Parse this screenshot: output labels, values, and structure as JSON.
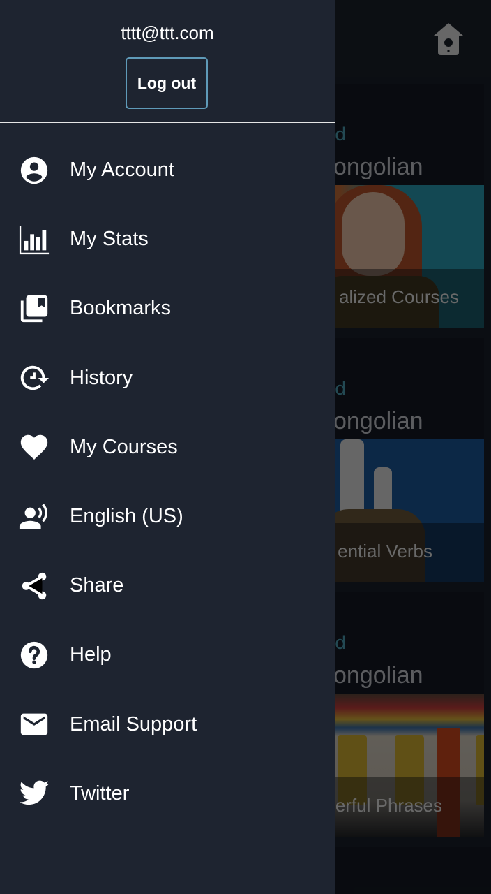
{
  "drawer": {
    "user_email": "tttt@ttt.com",
    "logout_label": "Log out",
    "items": [
      {
        "label": "My Account",
        "icon": "account-circle-icon"
      },
      {
        "label": "My Stats",
        "icon": "bar-chart-icon"
      },
      {
        "label": "Bookmarks",
        "icon": "bookmarks-icon"
      },
      {
        "label": "History",
        "icon": "history-icon"
      },
      {
        "label": "My Courses",
        "icon": "heart-icon"
      },
      {
        "label": "English (US)",
        "icon": "voice-language-icon"
      },
      {
        "label": "Share",
        "icon": "share-icon"
      },
      {
        "label": "Help",
        "icon": "help-circle-icon"
      },
      {
        "label": "Email Support",
        "icon": "email-icon"
      },
      {
        "label": "Twitter",
        "icon": "twitter-icon"
      }
    ]
  },
  "background": {
    "header_icon": "birdhouse-home-icon",
    "courses": [
      {
        "level_fragment": "d",
        "language_fragment": "ongolian",
        "title_fragment": "alized Courses"
      },
      {
        "level_fragment": "d",
        "language_fragment": "ongolian",
        "title_fragment": "ential Verbs"
      },
      {
        "level_fragment": "d",
        "language_fragment": "ongolian",
        "title_fragment": "erful Phrases"
      }
    ]
  },
  "colors": {
    "drawer_bg": "#1e2430",
    "logout_border": "#5f9ab8",
    "divider": "#e6e6e6",
    "text": "#ffffff",
    "level_accent": "#4fa3b8"
  }
}
